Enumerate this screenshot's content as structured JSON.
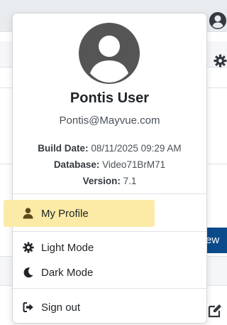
{
  "user": {
    "name": "Pontis User",
    "email": "Pontis@Mayvue.com"
  },
  "info": {
    "build_label": "Build Date:",
    "build_value": "08/11/2025 09:29 AM",
    "database_label": "Database:",
    "database_value": "Video71BrM71",
    "version_label": "Version:",
    "version_value": "7.1"
  },
  "menu": {
    "my_profile": "My Profile",
    "light_mode": "Light Mode",
    "dark_mode": "Dark Mode",
    "sign_out": "Sign out"
  },
  "background": {
    "new_button_fragment": "ew"
  },
  "icons": {
    "profile": "user-icon",
    "light": "gear-icon",
    "dark": "moon-icon",
    "signout": "sign-out-icon"
  },
  "colors": {
    "highlight": "#fbeba6",
    "avatar": "#555555",
    "accent_button": "#0b4a8b"
  }
}
